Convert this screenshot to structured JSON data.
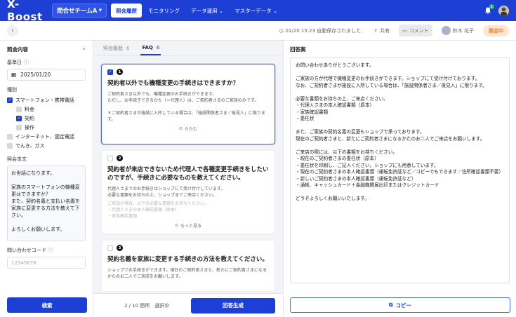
{
  "app": {
    "logo": "X-Boost",
    "team": "問合せチームA"
  },
  "nav": [
    {
      "label": "照会履歴",
      "active": true
    },
    {
      "label": "モニタリング",
      "active": false
    },
    {
      "label": "データ運用 ⌄",
      "active": false
    },
    {
      "label": "マスターデータ ⌄",
      "active": false
    }
  ],
  "notifications": {
    "count": "1"
  },
  "subbar": {
    "autosave": "01/20 15:23 自動保存されました",
    "share": "共有",
    "comment": "コメント",
    "user": "鈴木 花子",
    "status": "照会中"
  },
  "left": {
    "title": "照会内容",
    "date_label": "基準日",
    "date_value": "2025/01/20",
    "category_label": "種別",
    "categories": [
      {
        "label": "スマートフォン・携帯電話",
        "checked": true,
        "indent": false
      },
      {
        "label": "料金",
        "checked": false,
        "indent": true
      },
      {
        "label": "契約",
        "checked": true,
        "indent": true
      },
      {
        "label": "操作",
        "checked": false,
        "indent": true
      },
      {
        "label": "インターネット、固定電話",
        "checked": false,
        "indent": false
      },
      {
        "label": "でんき、ガス",
        "checked": false,
        "indent": false
      }
    ],
    "body_label": "照会本文",
    "body_text": "お世話になります。\n\n家族のスマートフォンの機種変更はできますか？\nまた、契約名義と支払い名義を家族に変更する方法を教えて下さい。\n\nよろしくお願いします。",
    "code_label": "問い合わせコード",
    "code_placeholder": "12345678",
    "search_button": "検索"
  },
  "mid": {
    "tabs": [
      {
        "label": "照会履歴",
        "count": "6",
        "active": false
      },
      {
        "label": "FAQ",
        "count": "6",
        "active": true
      }
    ],
    "cards": [
      {
        "num": "1",
        "checked": true,
        "title": "契約者以外でも機種変更の手続きはできますか？",
        "body": "ご契約者さま以外でも、機種変更のお手続きができます。\nただし、お手続きできるかた（＝代理人）は、ご契約者さまのご家族のみです。\n\n＊ご契約者さまが施設に入所している場合は、「施設関係者さま／後見人」に限ります。",
        "faded": "",
        "link": "たたむ"
      },
      {
        "num": "2",
        "checked": false,
        "title": "契約者が来店できないため代理人で各種変更手続きをしたいのですが、手続きに必要なものを教えてください。",
        "body": "代理人さまでのお手続きはショップにて受け付けしています。\n必要な書類をお持ちの上、ショップまでご来店ください。",
        "faded": "ご家族の場合、以下の必要な書類をお持ちください。\n・代理人さまの本人確認書類（原本）\n・家族確認書類",
        "link": "もっと見る"
      },
      {
        "num": "3",
        "checked": false,
        "title": "契約名義を家族に変更する手続きの方法を教えてください。",
        "body": "ショップでお手続きができます。現在のご契約者さまと、新たにご契約者さまになるかたのお二人でご来店をお願いします。",
        "faded": "",
        "link": ""
      }
    ],
    "selection": "2 / 10 箇所　選択中",
    "generate_button": "回答生成"
  },
  "right": {
    "title": "回答案",
    "answer": "お問い合わせありがとうございます。\n\nご家族の方が代理で機種変更のお手続きができます。ショップにて受け付けております。\nなお、ご契約者さまが施設に入所している場合は、「施設関係者さま／後見人」に限ります。\n\n必要な書類をお持ちの上、ご来店ください。\n・代理人さまの本人確認書類（原本）\n・家族確認書類\n・委任状\n\nまた、ご家族の契約名義の変更もショップで承っております。\n現在のご契約者さまと、新たにご契約者さまになるかたのお二人でご来店をお願いします。\n\nご来店の際には、以下の書類をお持ちください。\n・現在のご契約者さまの委任状（原本）\n・委任状を印刷し、ご記入ください。ショップにも用意しています。\n・現在のご契約者さまの本人確認書類（運転免許証など／コピーでもできます／住所確認書類不要）\n・新しいご契約者さまの本人確認書類（運転免許証など）\n・通帳、キャッシュカード＋金融機関届出印またはクレジットカード\n\nどうぞよろしくお願いいたします。",
    "copy_button": "コピー"
  }
}
